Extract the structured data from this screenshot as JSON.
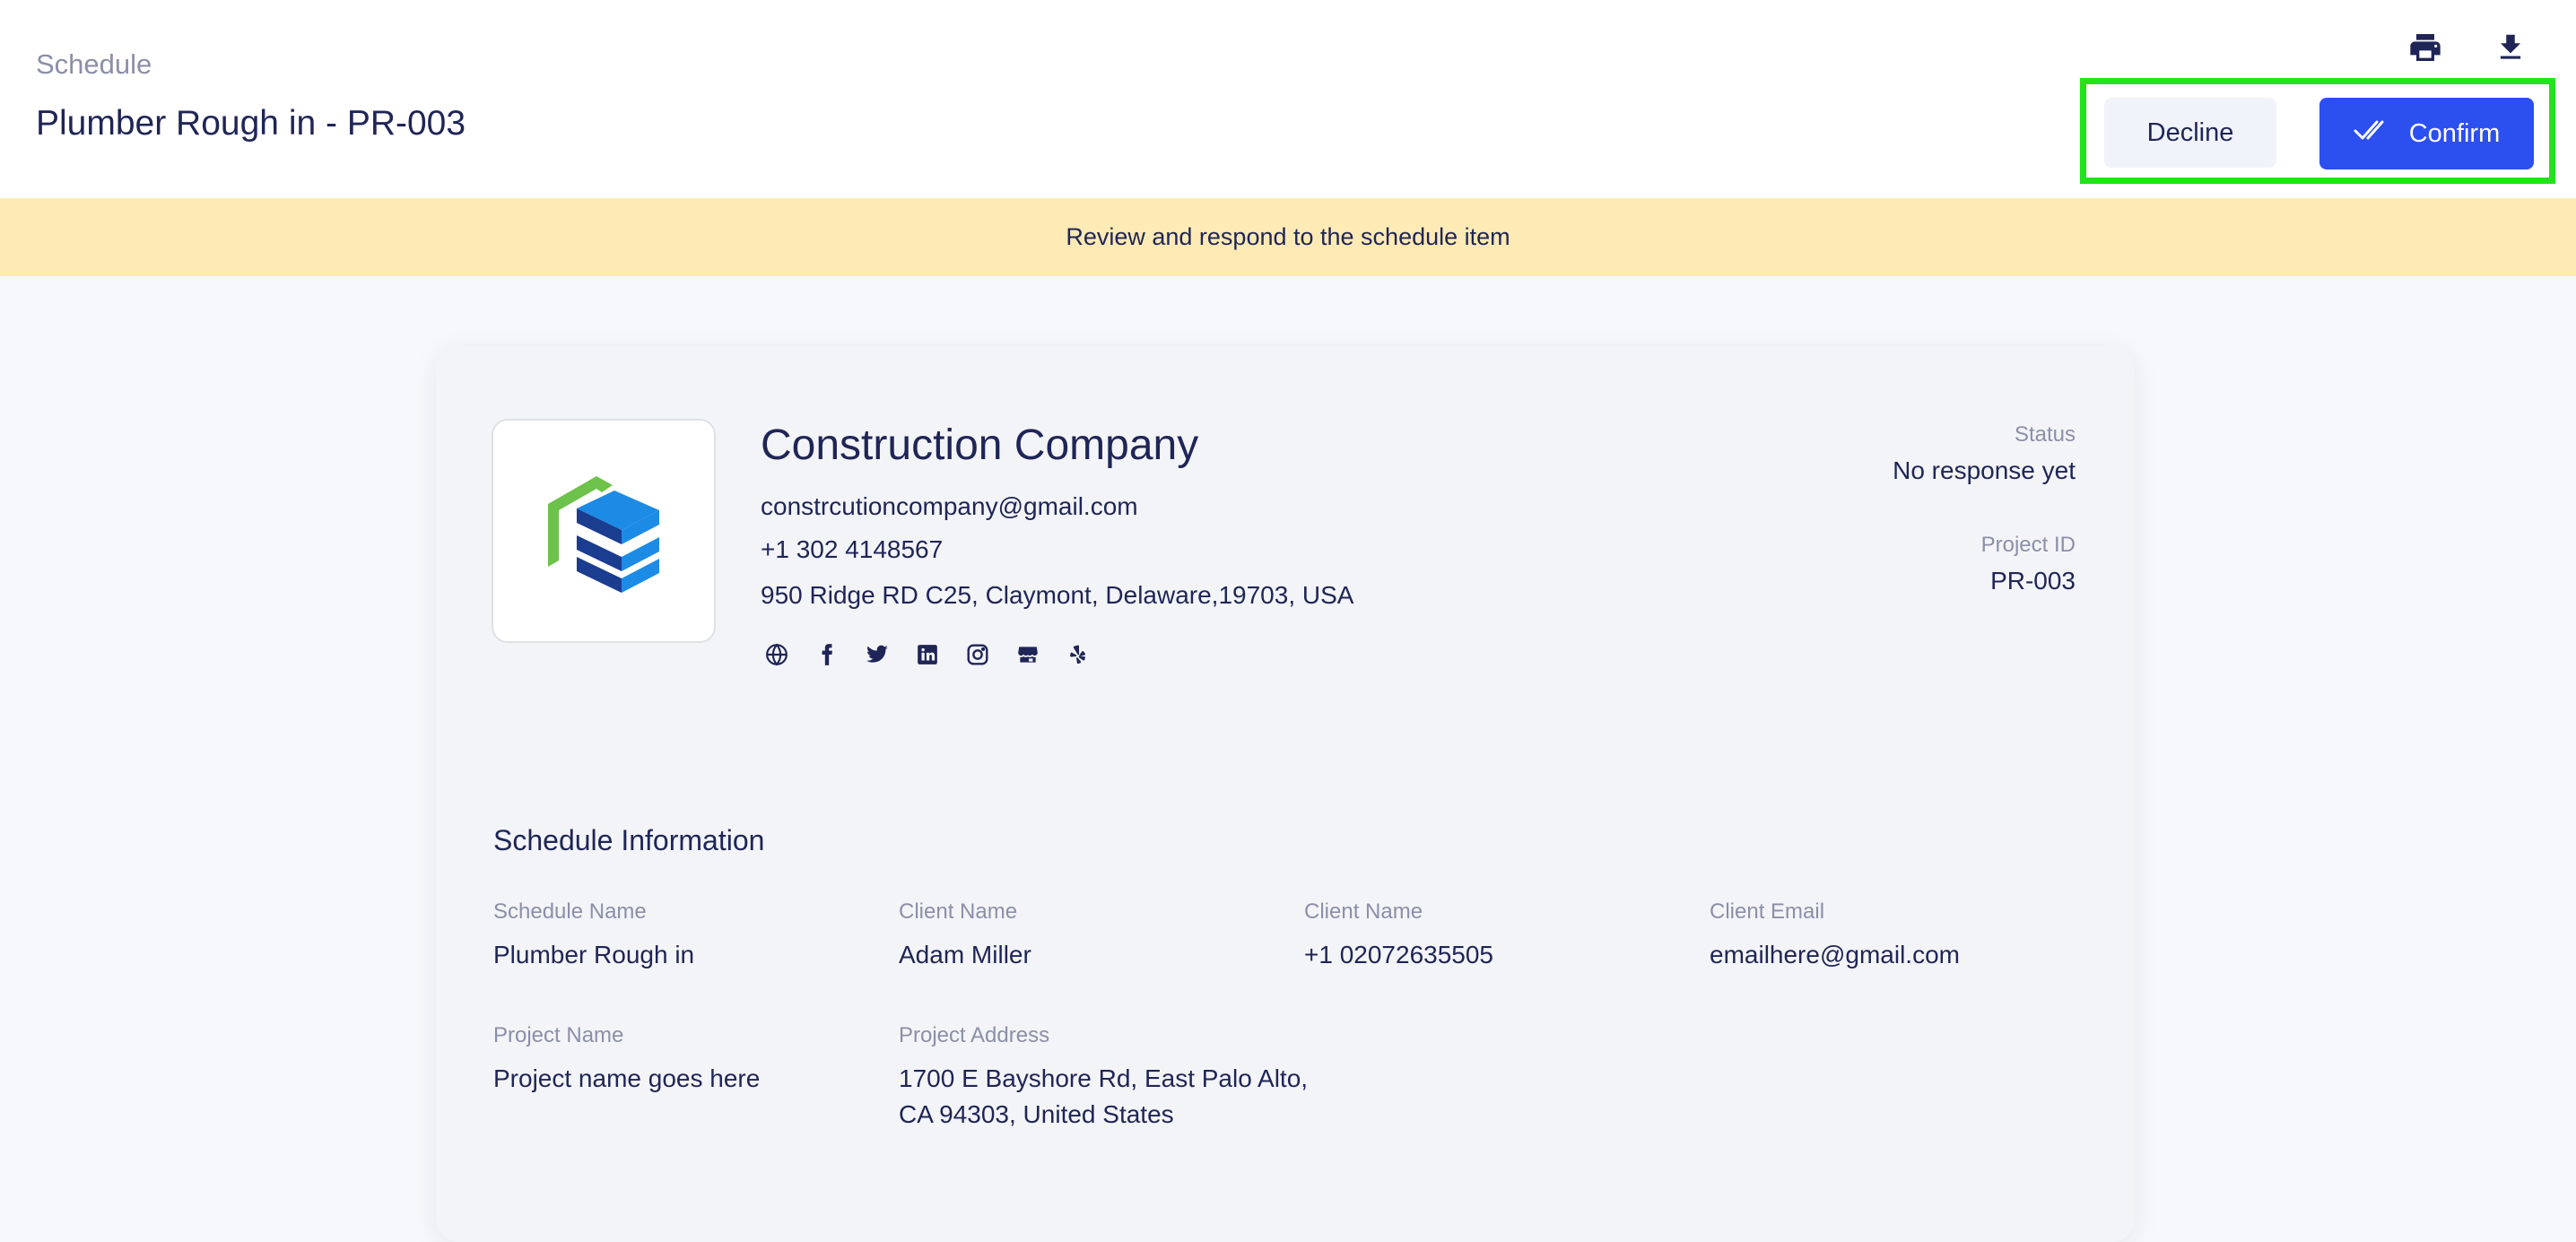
{
  "header": {
    "breadcrumb": "Schedule",
    "title": "Plumber Rough in - PR-003",
    "icons": [
      "print-icon",
      "download-icon"
    ],
    "decline_label": "Decline",
    "confirm_label": "Confirm",
    "confirm_icon": "double-check-icon"
  },
  "banner": {
    "text": "Review and respond to the schedule item"
  },
  "company": {
    "name": "Construction Company",
    "email": "constrcutioncompany@gmail.com",
    "phone": "+1 302 4148567",
    "address": "950 Ridge RD C25, Claymont, Delaware,19703, USA",
    "socials": [
      "globe-icon",
      "facebook-icon",
      "twitter-icon",
      "linkedin-icon",
      "instagram-icon",
      "store-icon",
      "yelp-icon"
    ]
  },
  "meta": {
    "status_label": "Status",
    "status_value": "No response yet",
    "project_id_label": "Project ID",
    "project_id_value": "PR-003"
  },
  "schedule_info": {
    "title": "Schedule Information",
    "fields": [
      {
        "label": "Schedule Name",
        "value": "Plumber Rough in"
      },
      {
        "label": "Client Name",
        "value": "Adam Miller"
      },
      {
        "label": "Client Name",
        "value": "+1 02072635505"
      },
      {
        "label": "Client Email",
        "value": "emailhere@gmail.com"
      },
      {
        "label": "Project Name",
        "value": "Project name goes here"
      },
      {
        "label": "Project Address",
        "value": "1700 E Bayshore Rd, East Palo Alto,",
        "value_line2": "CA 94303, United States"
      }
    ]
  },
  "colors": {
    "primary": "#2c4ff0",
    "text": "#1f2556",
    "muted": "#8b8fa8",
    "banner": "#feeab4",
    "highlight": "#22e31c",
    "logo_green": "#6cc24a",
    "logo_blue": "#1c8be6",
    "logo_navy": "#1a3d8f"
  }
}
